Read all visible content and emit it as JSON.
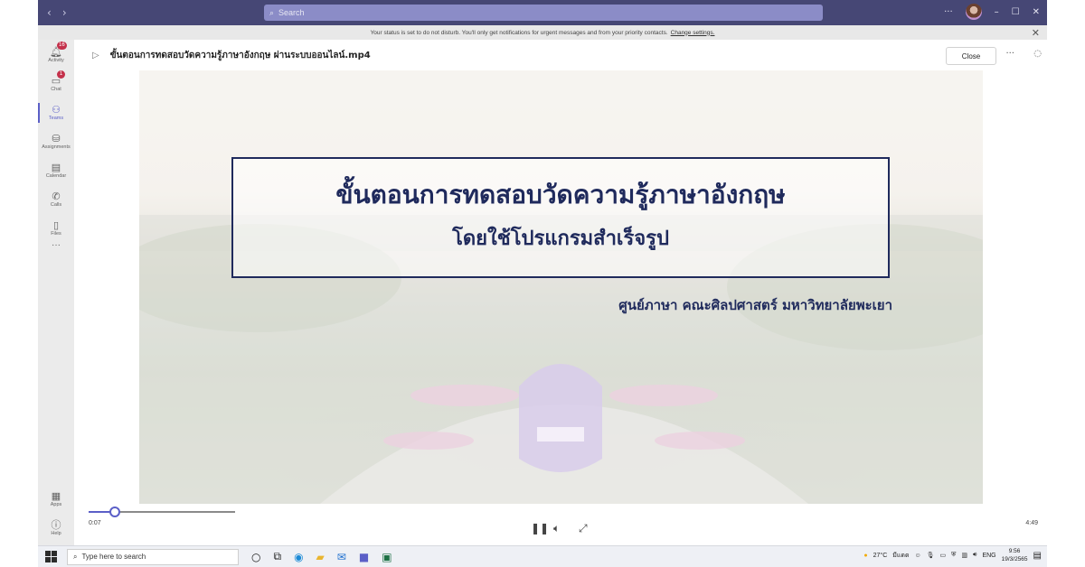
{
  "titlebar": {
    "search_placeholder": "Search",
    "nav_back": "‹",
    "nav_forward": "›",
    "more": "···",
    "minimize": "–",
    "maximize": "☐",
    "close": "✕"
  },
  "notice": {
    "text": "Your status is set to do not disturb. You'll only get notifications for urgent messages and from your priority contacts.",
    "link": "Change settings."
  },
  "rail": {
    "items": [
      {
        "label": "Activity",
        "badge": "16"
      },
      {
        "label": "Chat",
        "badge": "1"
      },
      {
        "label": "Teams",
        "badge": ""
      },
      {
        "label": "Assignments",
        "badge": ""
      },
      {
        "label": "Calendar",
        "badge": ""
      },
      {
        "label": "Calls",
        "badge": ""
      },
      {
        "label": "Files",
        "badge": ""
      },
      {
        "label": "···",
        "badge": ""
      },
      {
        "label": "Apps",
        "badge": ""
      },
      {
        "label": "Help",
        "badge": ""
      }
    ]
  },
  "file": {
    "name": "ขั้นตอนการทดสอบวัดความรู้ภาษาอังกฤษ ผ่านระบบออนไลน์.mp4",
    "close_label": "Close",
    "more": "···"
  },
  "video": {
    "title": "ขั้นตอนการทดสอบวัดความรู้ภาษาอังกฤษ",
    "subtitle": "โดยใช้โปรแกรมสำเร็จรูป",
    "organization": "ศูนย์ภาษา คณะศิลปศาสตร์ มหาวิทยาลัยพะเยา",
    "current_time": "0:07",
    "duration": "4:49",
    "progress_fraction": 0.024
  },
  "taskbar": {
    "search_placeholder": "Type here to search",
    "weather": "27°C",
    "weather_desc": "มีแดด",
    "language": "ENG",
    "time": "9:56",
    "date": "19/3/2565"
  },
  "colors": {
    "teams_purple": "#464775",
    "accent": "#5b5fc7",
    "title_navy": "#1f2a5c"
  }
}
